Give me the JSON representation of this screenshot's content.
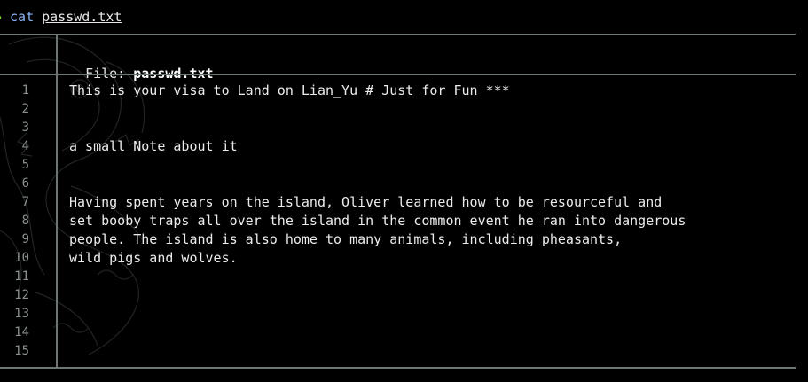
{
  "terminal": {
    "prompt_symbol": "❯",
    "command": "cat",
    "argument": "passwd.txt"
  },
  "viewer": {
    "file_label": "File: ",
    "file_name": "passwd.txt",
    "line_numbers": [
      "1",
      "2",
      "3",
      "4",
      "5",
      "6",
      "7",
      "8",
      "9",
      "10",
      "11",
      "12",
      "13",
      "14",
      "15"
    ],
    "lines": [
      "This is your visa to Land on Lian_Yu # Just for Fun ***",
      "",
      "",
      "a small Note about it",
      "",
      "",
      "Having spent years on the island, Oliver learned how to be resourceful and",
      "set booby traps all over the island in the common event he ran into dangerous",
      "people. The island is also home to many animals, including pheasants,",
      "wild pigs and wolves.",
      "",
      "",
      "",
      "",
      ""
    ]
  },
  "colors": {
    "background": "#000000",
    "prompt_green": "#7bd321",
    "command_blue": "#8ab4f8",
    "border_gray": "#6e7575",
    "line_number_gray": "#8a8f8f"
  },
  "icons": {
    "background_art": "dragon-line-art"
  }
}
